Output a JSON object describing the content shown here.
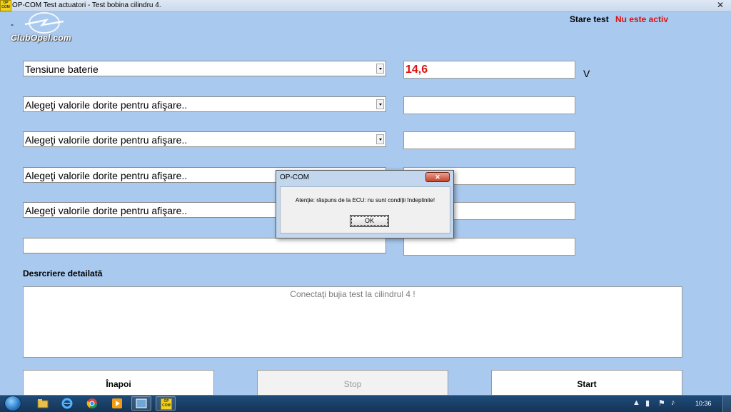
{
  "window": {
    "app_icon_text": "OP COM",
    "title": "OP-COM   Test actuatori - Test bobina cilindru 4.",
    "close_glyph": "✕"
  },
  "header": {
    "dash": "-",
    "logo_text": "ClubOpel.com",
    "status_label": "Stare test",
    "status_value": "Nu este activ"
  },
  "rows": [
    {
      "select": "Tensiune baterie",
      "value": "14,6",
      "unit": "V"
    },
    {
      "select": "Alegeţi valorile dorite pentru afişare..",
      "value": ""
    },
    {
      "select": "Alegeţi valorile dorite pentru afişare..",
      "value": ""
    },
    {
      "select": "Alegeţi valorile dorite pentru afişare..",
      "value": ""
    },
    {
      "select": "Alegeţi valorile dorite pentru afişare..",
      "value": ""
    },
    {
      "select": "",
      "value": ""
    }
  ],
  "description": {
    "label": "Desrcriere detailată",
    "text": "Conectaţi bujia test la cilindrul 4 !"
  },
  "buttons": {
    "back": "Înapoi",
    "stop": "Stop",
    "start": "Start"
  },
  "dialog": {
    "title": "OP-COM",
    "message": "Atenţie: răspuns de la ECU: nu sunt condiţii îndeplinite!",
    "ok": "OK",
    "close_glyph": "✕"
  },
  "taskbar": {
    "app_badge": "OP COM",
    "clock": "10:36"
  },
  "colors": {
    "background": "#a9c9ee",
    "status_red": "#e01010"
  }
}
